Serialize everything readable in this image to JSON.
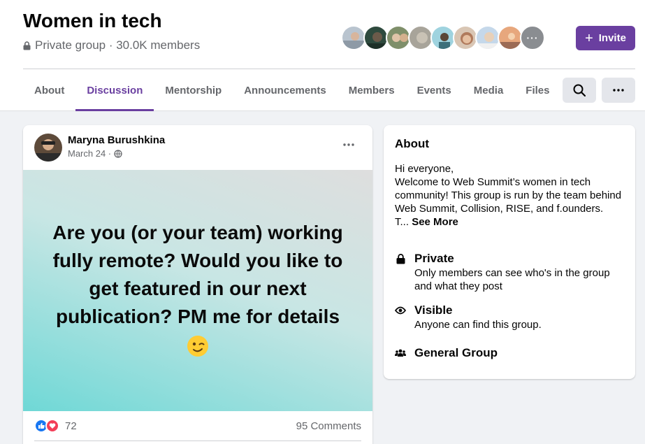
{
  "group": {
    "title": "Women in tech",
    "meta": "Private group · 30.0K members"
  },
  "header": {
    "invite_label": "Invite",
    "members_more": "···"
  },
  "tabs": [
    {
      "label": "About"
    },
    {
      "label": "Discussion",
      "active": true
    },
    {
      "label": "Mentorship"
    },
    {
      "label": "Announcements"
    },
    {
      "label": "Members"
    },
    {
      "label": "Events"
    },
    {
      "label": "Media"
    },
    {
      "label": "Files"
    }
  ],
  "post": {
    "author": "Maryna Burushkina",
    "date": "March 24 ·",
    "privacy_icon": "globe-icon",
    "image_text": "Are you (or your team) working fully remote? Would you like to get featured in our next publication? PM me for details",
    "emoji": "winking-face-icon",
    "reaction_count": "72",
    "comments": "95 Comments"
  },
  "about": {
    "title": "About",
    "description": "Hi everyone,\nWelcome to Web Summit’s women in tech community! This group is run by the team behind Web Summit, Collision, RISE, and f.ounders.\nT...",
    "see_more": "See More",
    "items": [
      {
        "icon": "lock-icon",
        "title": "Private",
        "subtitle": "Only members can see who's in the group and what they post"
      },
      {
        "icon": "eye-icon",
        "title": "Visible",
        "subtitle": "Anyone can find this group."
      },
      {
        "icon": "people-icon",
        "title": "General Group",
        "subtitle": ""
      }
    ]
  },
  "colors": {
    "accent": "#6a3fa0",
    "like": "#1877f2",
    "love": "#f33e58"
  }
}
